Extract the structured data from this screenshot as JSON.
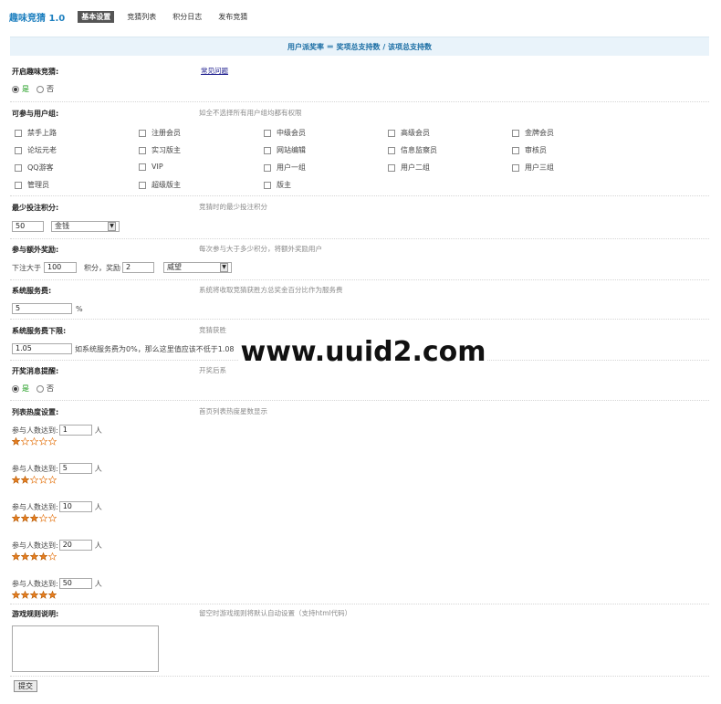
{
  "nav": {
    "title": "趣味竞猜 1.0",
    "tabs": [
      "基本设置",
      "竞猜列表",
      "积分日志",
      "发布竞猜"
    ]
  },
  "formula": "用户派奖率 ＝ 奖项总支持数 / 该项总支持数",
  "open": {
    "label": "开启趣味竞猜:",
    "link": "常见问题",
    "yes": "是",
    "no": "否"
  },
  "groups": {
    "label": "可参与用户组:",
    "hint": "如全不选择所有用户组均都有权限",
    "items": [
      [
        "禁手上路",
        "注册会员",
        "中级会员",
        "高级会员",
        "金牌会员"
      ],
      [
        "论坛元老",
        "实习版主",
        "网站编辑",
        "信息监察员",
        "审核员"
      ],
      [
        "QQ游客",
        "VIP",
        "用户一组",
        "用户二组",
        "用户三组"
      ],
      [
        "管理员",
        "超级版主",
        "版主"
      ]
    ]
  },
  "min_bet": {
    "label": "最少投注积分:",
    "hint": "竞猜时的最少投注积分",
    "value": "50",
    "currency": "金钱"
  },
  "extra": {
    "label": "参与额外奖励:",
    "hint": "每次参与大于多少积分，将额外奖励用户",
    "t1": "下注大于",
    "v1": "100",
    "t2": "积分，奖励",
    "v2": "2",
    "currency": "威望"
  },
  "fee": {
    "label": "系统服务费:",
    "hint": "系统将收取竞猜获胜方总奖金百分比作为服务费",
    "value": "5",
    "unit": "%"
  },
  "fee_min": {
    "label": "系统服务费下限:",
    "hint": "竞猜获胜",
    "value": "1.05",
    "note": "如系统服务费为0%，那么这里值应该不低于1.08"
  },
  "notify": {
    "label": "开奖消息提醒:",
    "hint": "开奖后系",
    "yes": "是",
    "no": "否"
  },
  "hot": {
    "label": "列表热度设置:",
    "hint": "首页列表热度星数显示",
    "prefix": "参与人数达到:",
    "unit": "人",
    "levels": [
      {
        "value": "1",
        "stars": 1
      },
      {
        "value": "5",
        "stars": 2
      },
      {
        "value": "10",
        "stars": 3
      },
      {
        "value": "20",
        "stars": 4
      },
      {
        "value": "50",
        "stars": 5
      }
    ]
  },
  "rules": {
    "label": "游戏规则说明:",
    "hint": "留空时游戏规则将默认自动设置（支持html代码）"
  },
  "submit": "提交",
  "watermark": "www.uuid2.com",
  "colors": {
    "star": "#e67e22",
    "accent": "#1d7fbf",
    "formula_bg": "#e9f3fa"
  }
}
